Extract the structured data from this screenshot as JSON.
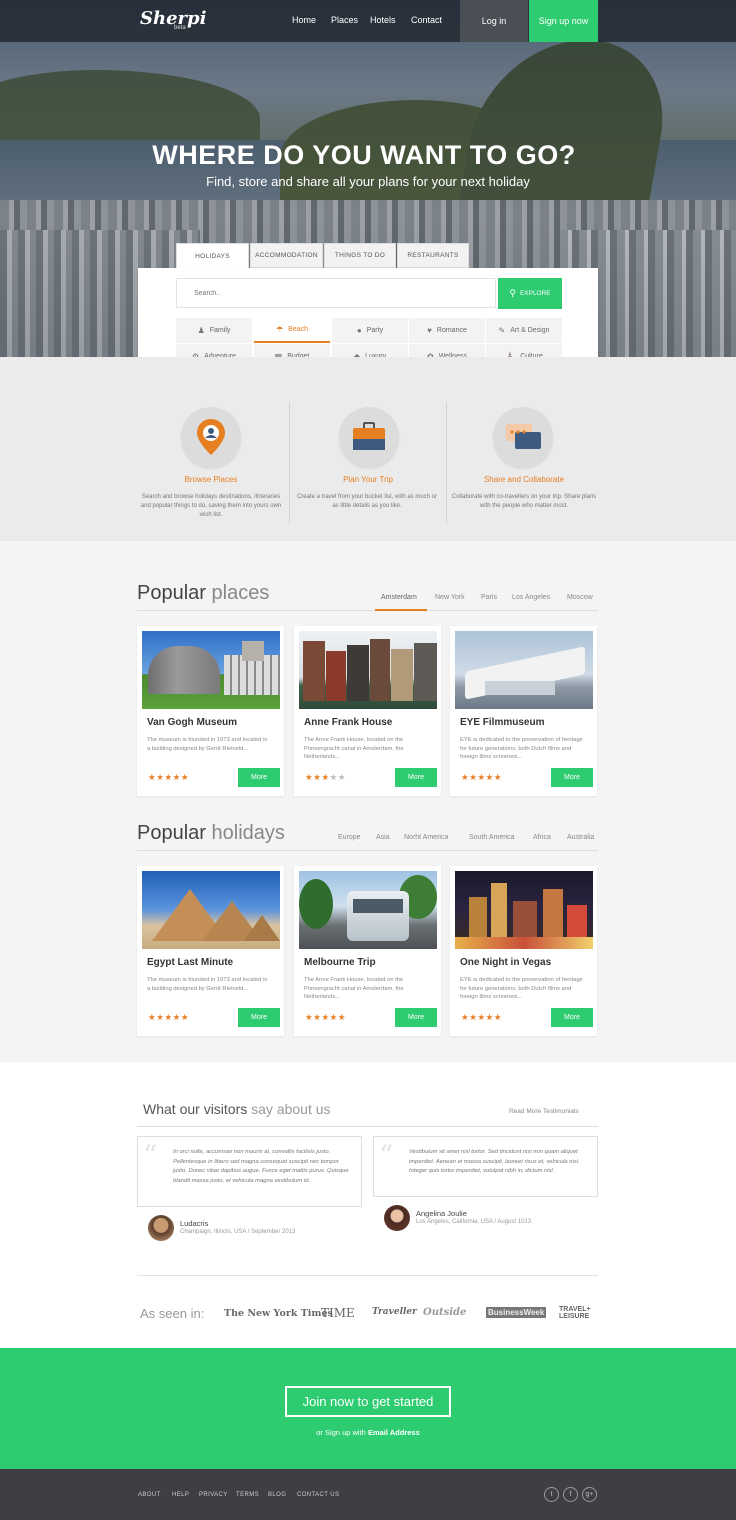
{
  "nav": {
    "logo": "Sherpi",
    "logo_badge": "beta",
    "links": [
      "Home",
      "Places",
      "Hotels",
      "Contact"
    ],
    "login": "Log in",
    "signup": "Sign up now"
  },
  "hero": {
    "title": "WHERE DO YOU WANT TO GO?",
    "subtitle": "Find, store and share all your plans for your next holiday"
  },
  "search": {
    "tabs": [
      "HOLIDAYS",
      "ACCOMMODATION",
      "THINGS TO DO",
      "RESTAURANTS"
    ],
    "active_tab": "HOLIDAYS",
    "placeholder": "Search..",
    "button": "EXPLORE",
    "categories": [
      {
        "label": "Family",
        "icon": "family-icon"
      },
      {
        "label": "Beach",
        "icon": "beach-icon"
      },
      {
        "label": "Party",
        "icon": "party-icon"
      },
      {
        "label": "Romance",
        "icon": "heart-icon"
      },
      {
        "label": "Art & Design",
        "icon": "pencil-icon"
      },
      {
        "label": "Adventure",
        "icon": "bike-icon"
      },
      {
        "label": "Budget",
        "icon": "wallet-icon"
      },
      {
        "label": "Luxury",
        "icon": "diamond-icon"
      },
      {
        "label": "Wellness",
        "icon": "leaf-icon"
      },
      {
        "label": "Culture",
        "icon": "museum-icon"
      }
    ],
    "active_category": "Beach"
  },
  "features": [
    {
      "title": "Browse Places",
      "desc": "Search and browse holidays destinations, itineraries and popular things to do, saving them into yours own wish list.",
      "icon": "map-pin-icon"
    },
    {
      "title": "Plan Your Trip",
      "desc": "Create a travel from your bucket list, with as much or as little details as you like.",
      "icon": "suitcase-icon"
    },
    {
      "title": "Share and Collaborate",
      "desc": "Collaborate with co-travellers on your trip. Share plans with the people who matter most.",
      "icon": "chat-icon"
    }
  ],
  "popular_places": {
    "title_bold": "Popular",
    "title_light": "places",
    "filters": [
      "Amsterdam",
      "New York",
      "Paris",
      "Los Angeles",
      "Moscow"
    ],
    "active_filter": "Amsterdam",
    "cards": [
      {
        "title": "Van Gogh Museum",
        "desc": "The museum is founded in 1973 and located in a building designed by Gerrit Rietveld...",
        "rating": 5,
        "more": "More"
      },
      {
        "title": "Anne Frank House",
        "desc": "The Anne Frank House, located on the Prinsengracht canal in Amsterdam, the Netherlands...",
        "rating": 3,
        "more": "More"
      },
      {
        "title": "EYE Filmmuseum",
        "desc": "EYE is dedicated to the preservation of heritage for future generations, both Dutch films and foreign films screened...",
        "rating": 5,
        "more": "More"
      }
    ]
  },
  "popular_holidays": {
    "title_bold": "Popular",
    "title_light": "holidays",
    "filters": [
      "Europe",
      "Asia",
      "Norht America",
      "South America",
      "Africa",
      "Australia"
    ],
    "cards": [
      {
        "title": "Egypt Last Minute",
        "desc": "The museum is founded in 1973 and located in a building designed by Gerrit Rietveld...",
        "rating": 5,
        "more": "More"
      },
      {
        "title": "Melbourne Trip",
        "desc": "The Anne Frank House, located on the Prinsengracht canal in Amsterdam, the Netherlands...",
        "rating": 5,
        "more": "More"
      },
      {
        "title": "One Night in Vegas",
        "desc": "EYE is dedicated to the preservation of heritage for future generations, both Dutch films and foreign films screened...",
        "rating": 5,
        "more": "More"
      }
    ]
  },
  "testimonials": {
    "title_bold": "What our visitors",
    "title_light": "say about us",
    "read_more": "Read More Testimonials",
    "items": [
      {
        "text": "In orci nulla, accumsan non mauris at, convallis facilisis justo. Pellentesque in libero sed magna consequat suscipit nec tempor justo. Donec vitae dapibus augue. Fusce eget mattis purus. Quisque blandit massa justo, et vehicula magna vestibulum id.",
        "name": "Ludacris",
        "meta": "Champaign, Illinois, USA / September 2013"
      },
      {
        "text": "Vestibulum sit amet nisl tortor. Sed tincidunt nisi non quam aliquet imperdiet. Aenean et massa suscipit, laoreet risus et, vehicula nisi. Integer quis tortor imperdiet, volutpat nibh in, dictum nisl.",
        "name": "Angelina Joulie",
        "meta": "Los Angeles, California, USA / August 1013"
      }
    ]
  },
  "seen_in": {
    "label": "As seen in:",
    "logos": [
      "The New York Times",
      "TIME",
      "Traveller",
      "Outside",
      "BusinessWeek",
      "TRAVEL+ LEISURE"
    ]
  },
  "cta": {
    "button": "Join now to get started",
    "alt_prefix": "or Sign up with",
    "alt_link": "Email Address"
  },
  "footer": {
    "links": [
      "ABOUT",
      "HELP",
      "PRIVACY",
      "TERMS",
      "BLOG",
      "CONTACT US"
    ],
    "social": [
      "twitter-icon",
      "facebook-icon",
      "google-plus-icon"
    ]
  },
  "colors": {
    "accent": "#2ecc71",
    "highlight": "#e67e22",
    "footer": "#3d3f45"
  }
}
